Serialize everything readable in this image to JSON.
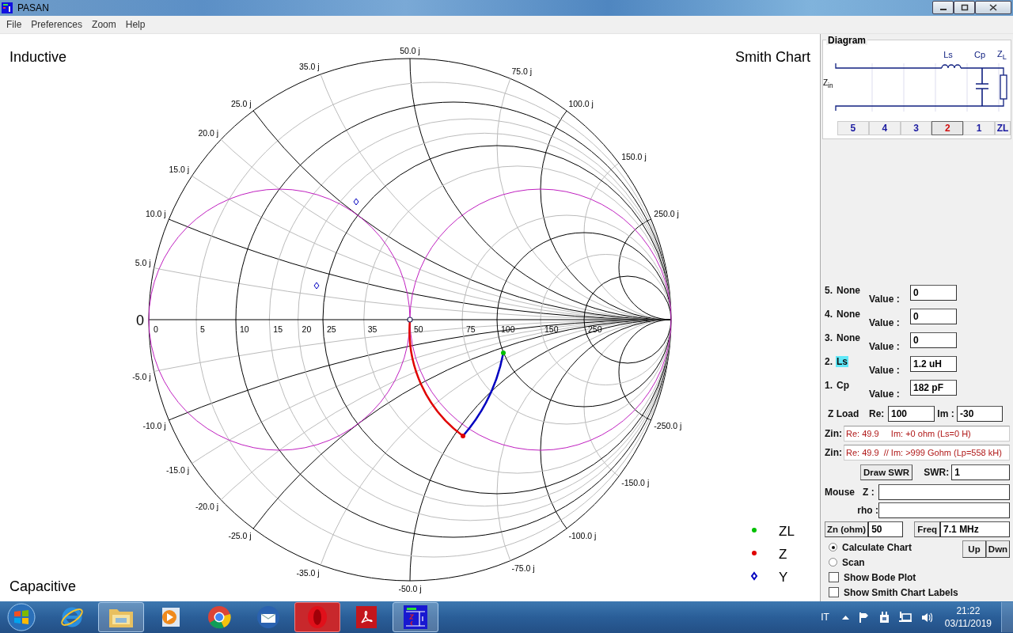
{
  "window": {
    "title": "PASAN"
  },
  "menu": [
    "File",
    "Preferences",
    "Zoom",
    "Help"
  ],
  "chart": {
    "title": "Smith Chart",
    "top_label": "Inductive",
    "bottom_label": "Capacitive",
    "center_label": "0",
    "resistance_labels": [
      "0",
      "5",
      "10",
      "15",
      "20",
      "25",
      "35",
      "50",
      "75",
      "100",
      "150",
      "250"
    ],
    "reactance_labels_positive": [
      "5.0 j",
      "10.0 j",
      "15.0 j",
      "20.0 j",
      "25.0 j",
      "35.0 j",
      "50.0 j",
      "75.0 j",
      "100.0 j",
      "150.0 j",
      "250.0 j"
    ],
    "reactance_labels_negative": [
      "-5.0 j",
      "-10.0 j",
      "-15.0 j",
      "-20.0 j",
      "-25.0 j",
      "-35.0 j",
      "-50.0 j",
      "-75.0 j",
      "-100.0 j",
      "-150.0 j",
      "-250.0 j"
    ]
  },
  "legend": [
    {
      "label": "ZL",
      "color": "#00c000",
      "kind": "dot"
    },
    {
      "label": "Z",
      "color": "#e00000",
      "kind": "dot"
    },
    {
      "label": "Y",
      "color": "#0000c0",
      "kind": "hollow"
    }
  ],
  "diagram": {
    "title": "Diagram",
    "input_label": "Z$_{in}$",
    "load_label": "Z$_{L}$",
    "slots": [
      {
        "kind": "none"
      },
      {
        "kind": "none"
      },
      {
        "kind": "none"
      },
      {
        "kind": "inductor",
        "label": "Ls"
      },
      {
        "kind": "capacitor",
        "label": "Cp"
      }
    ],
    "tabs": [
      {
        "label": "5",
        "selected": false
      },
      {
        "label": "4",
        "selected": false
      },
      {
        "label": "3",
        "selected": false
      },
      {
        "label": "2",
        "selected": true
      },
      {
        "label": "1",
        "selected": false
      },
      {
        "label": "ZL",
        "selected": false
      }
    ]
  },
  "components": [
    {
      "number": "5.",
      "name": "None",
      "selected": false,
      "value_label": "Value :",
      "value": "0"
    },
    {
      "number": "4.",
      "name": "None",
      "selected": false,
      "value_label": "Value :",
      "value": "0"
    },
    {
      "number": "3.",
      "name": "None",
      "selected": false,
      "value_label": "Value :",
      "value": "0"
    },
    {
      "number": "2.",
      "name": "Ls",
      "selected": true,
      "value_label": "Value :",
      "value": "1.2 uH"
    },
    {
      "number": "1.",
      "name": "Cp",
      "selected": false,
      "value_label": "Value :",
      "value": "182 pF"
    }
  ],
  "z_load": {
    "label": "Z Load",
    "re_label": "Re:",
    "re": "100",
    "im_label": "Im :",
    "im": "-30"
  },
  "zin": [
    {
      "label": "Zin:",
      "value": "Re: 49.9     Im: +0 ohm (Ls=0 H)"
    },
    {
      "label": "Zin:",
      "value": "Re: 49.9  // Im: >999 Gohm (Lp=558 kH)"
    }
  ],
  "swr": {
    "button": "Draw SWR",
    "label": "SWR:",
    "value": "1"
  },
  "mouse": {
    "label": "Mouse",
    "z_label": "Z :",
    "rho_label": "rho :"
  },
  "zn": {
    "button": "Zn (ohm)",
    "value": "50"
  },
  "freq": {
    "button": "Freq",
    "value": "7.1 MHz"
  },
  "modes": [
    {
      "label": "Calculate Chart",
      "selected": true
    },
    {
      "label": "Scan",
      "selected": false
    }
  ],
  "step_buttons": [
    "Up",
    "Dwn"
  ],
  "options": [
    {
      "label": "Show Bode Plot",
      "checked": false
    },
    {
      "label": "Show Smith Chart Labels",
      "checked": false
    }
  ],
  "taskbar": {
    "apps": [
      {
        "kind": "browser",
        "active": false
      },
      {
        "kind": "folder",
        "active": true
      },
      {
        "kind": "media",
        "active": false
      },
      {
        "kind": "chrome",
        "active": false
      },
      {
        "kind": "mail",
        "active": false
      },
      {
        "kind": "opera",
        "active": true
      },
      {
        "kind": "pdf",
        "active": false
      },
      {
        "kind": "pasan",
        "active": true
      }
    ],
    "language": "IT",
    "time": "21:22",
    "date": "03/11/2019"
  }
}
